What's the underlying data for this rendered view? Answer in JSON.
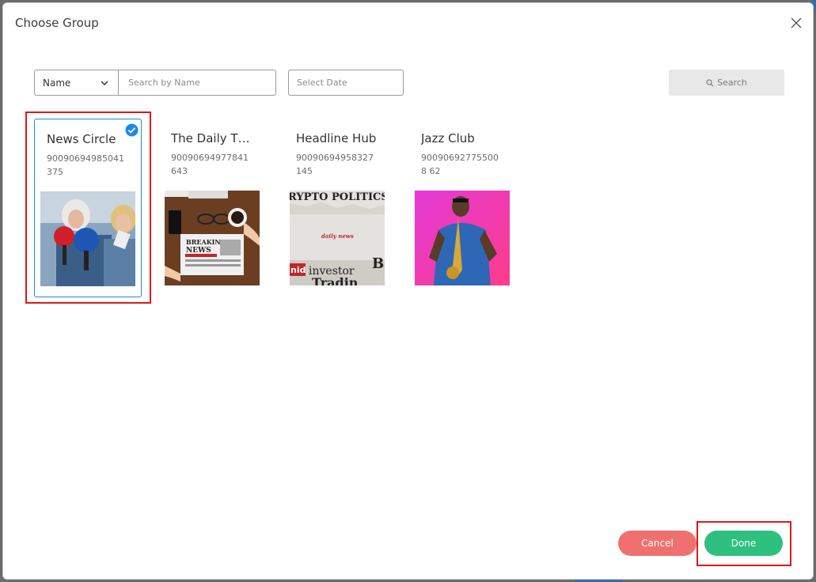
{
  "dialog": {
    "title": "Choose Group"
  },
  "filters": {
    "field_select": "Name",
    "search_placeholder": "Search by Name",
    "date_placeholder": "Select Date",
    "search_button": "Search"
  },
  "groups": [
    {
      "name": "News Circle",
      "phone": "90090694985041375",
      "selected": true,
      "image": "reporters-with-microphones"
    },
    {
      "name": "The Daily Thr...",
      "phone": "90090694977841643",
      "selected": false,
      "image": "breaking-news-newspaper-on-desk"
    },
    {
      "name": "Headline Hub",
      "phone": "90090694958327145",
      "selected": false,
      "image": "newspaper-clippings-crypto-politics"
    },
    {
      "name": "Jazz Club",
      "phone": "900906927755008 62",
      "selected": false,
      "image": "saxophone-player"
    }
  ],
  "thumb_text": {
    "breaking_line1": "BREAKING",
    "breaking_line2": "NEWS",
    "crypto_politics": "RYPTO POLITICS",
    "daily_news": "daily news",
    "investor": "investor",
    "trading": "Tradin",
    "nid": "nid",
    "b_letter": "B"
  },
  "footer": {
    "cancel_label": "Cancel",
    "done_label": "Done"
  },
  "colors": {
    "accent_blue": "#1e88e5",
    "cancel": "#f07070",
    "done": "#2ec07f",
    "highlight": "#e01818"
  }
}
